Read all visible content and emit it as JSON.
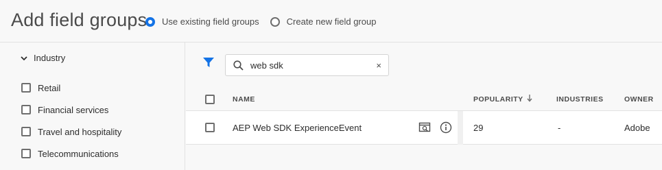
{
  "header": {
    "title": "Add field groups",
    "radios": [
      {
        "label": "Use existing field groups",
        "checked": true
      },
      {
        "label": "Create new field group",
        "checked": false
      }
    ]
  },
  "sidebar": {
    "facet_title": "Industry",
    "items": [
      {
        "label": "Retail"
      },
      {
        "label": "Financial services"
      },
      {
        "label": "Travel and hospitality"
      },
      {
        "label": "Telecommunications"
      }
    ]
  },
  "search": {
    "value": "web sdk",
    "clear_glyph": "×"
  },
  "table": {
    "columns": [
      "NAME",
      "POPULARITY",
      "INDUSTRIES",
      "OWNER"
    ],
    "rows": [
      {
        "name": "AEP Web SDK ExperienceEvent",
        "popularity": "29",
        "industries": "-",
        "owner": "Adobe"
      }
    ]
  },
  "icons": {
    "filter": "filter-icon",
    "search": "search-icon",
    "clear": "close-icon",
    "chevron": "chevron-down-icon",
    "sort": "arrow-down-icon",
    "preview": "preview-icon",
    "info": "info-icon"
  },
  "colors": {
    "accent": "#1473e6"
  }
}
